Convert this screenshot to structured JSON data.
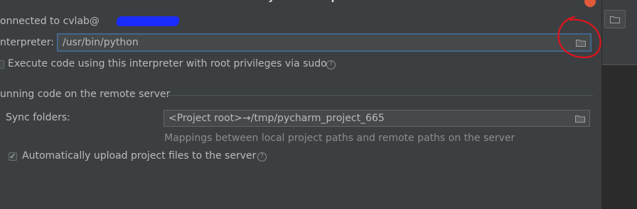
{
  "dialog": {
    "title": "Add Python Interpreter"
  },
  "connection": {
    "label": "onnected to cvlab@"
  },
  "interpreter": {
    "label": "nterpreter:",
    "value": "/usr/bin/python"
  },
  "root_privileges": {
    "label": "Execute code using this interpreter with root privileges via sudo",
    "checked": false
  },
  "remote_section": {
    "title": "unning code on the remote server",
    "sync_folders_label": "Sync folders:",
    "sync_folders_value": "<Project root>→/tmp/pycharm_project_665",
    "hint": "Mappings between local project paths and remote paths on the server",
    "auto_upload_label": "Automatically upload project files to the server",
    "auto_upload_checked": true
  },
  "icons": {
    "folder": "folder-icon",
    "help": "help-icon",
    "checkmark": "✓"
  },
  "colors": {
    "dialog_bg": "#3c3f41",
    "field_bg": "#45494a",
    "focus_border": "#3d6185",
    "annotation_red": "#e0141e",
    "redaction_blue": "#1a2cff"
  }
}
